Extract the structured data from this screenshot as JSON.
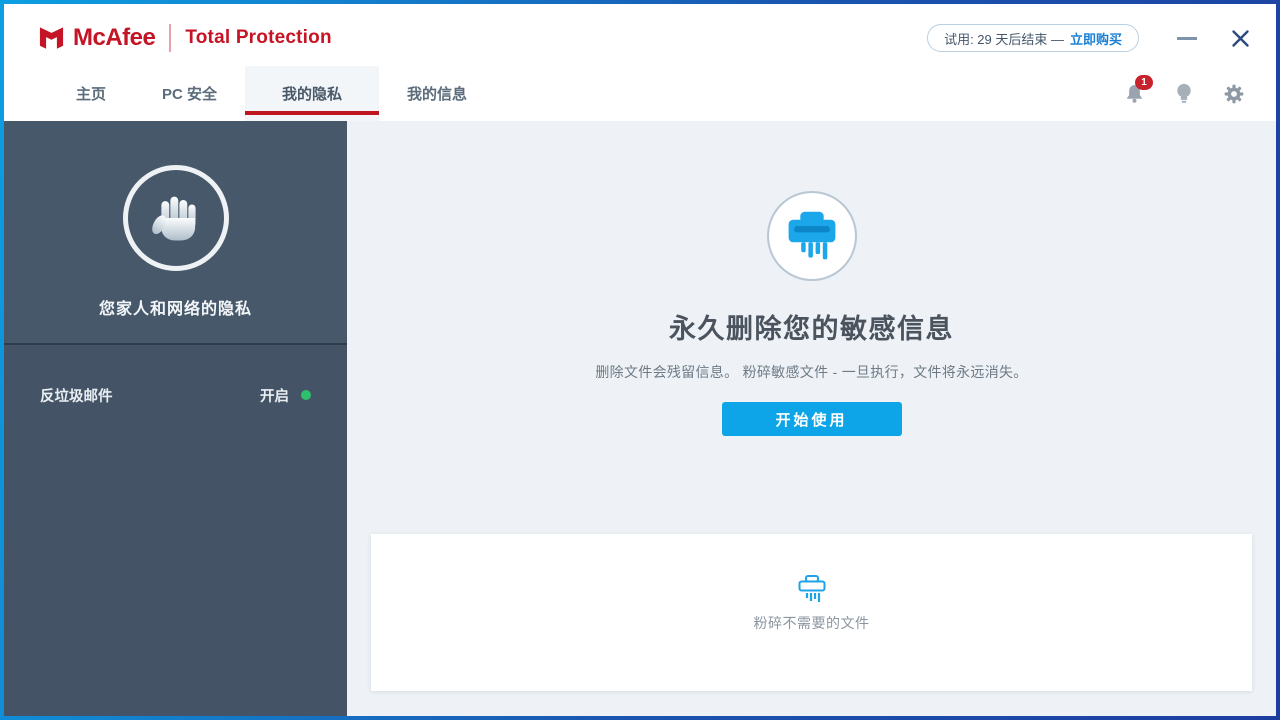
{
  "header": {
    "brand": "McAfee",
    "product": "Total Protection",
    "trial": {
      "text": "试用: 29 天后结束 —",
      "link": "立即购买"
    },
    "notifications": {
      "count": "1"
    },
    "tabs": [
      {
        "label": "主页",
        "active": false
      },
      {
        "label": "PC 安全",
        "active": false
      },
      {
        "label": "我的隐私",
        "active": true
      },
      {
        "label": "我的信息",
        "active": false
      }
    ]
  },
  "sidebar": {
    "title": "您家人和网络的隐私",
    "items": [
      {
        "label": "反垃圾邮件",
        "status": "开启",
        "status_color": "#2fc06c"
      }
    ]
  },
  "main": {
    "heading": "永久删除您的敏感信息",
    "description": "删除文件会残留信息。 粉碎敏感文件 - 一旦执行，文件将永远消失。",
    "cta": "开始使用",
    "card": {
      "label": "粉碎不需要的文件"
    }
  },
  "icons": {
    "logo": "mcafee-shield-icon",
    "header": [
      "bell-icon",
      "lightbulb-icon",
      "gear-icon"
    ],
    "window": [
      "minimize-icon",
      "close-icon"
    ],
    "sidebar": "stop-hand-icon",
    "hero": "shredder-icon",
    "card": "shredder-outline-icon"
  },
  "colors": {
    "brand_red": "#c41425",
    "tab_underline_red": "#c0161f",
    "accent_blue": "#0da4e8",
    "icon_blue": "#1ba7ea",
    "link_blue": "#1a7fd4",
    "status_green": "#2fc06c",
    "badge_red": "#c8232c",
    "sidebar_bg_top": "#48586b",
    "sidebar_bg_bottom": "#445466",
    "main_bg": "#eef2f6"
  }
}
